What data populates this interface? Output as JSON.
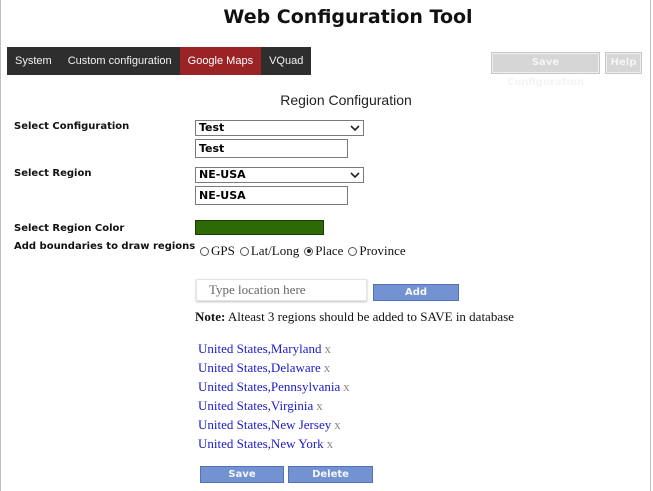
{
  "app": {
    "title": "Web Configuration Tool"
  },
  "nav": {
    "tabs": [
      {
        "label": "System",
        "active": false
      },
      {
        "label": "Custom configuration",
        "active": false
      },
      {
        "label": "Google Maps",
        "active": true
      },
      {
        "label": "VQuad",
        "active": false
      }
    ]
  },
  "toolbar": {
    "save_label": "Save Configuration",
    "help_label": "Help"
  },
  "section": {
    "title": "Region Configuration"
  },
  "form": {
    "config_label": "Select Configuration",
    "config_selected": "Test",
    "config_name": "Test",
    "region_label": "Select Region",
    "region_selected": "NE-USA",
    "region_name": "NE-USA",
    "color_label": "Select Region Color",
    "color_value": "#2c6a06",
    "boundaries_label": "Add boundaries to draw regions",
    "boundary_options": [
      {
        "label": "GPS",
        "checked": false
      },
      {
        "label": "Lat/Long",
        "checked": false
      },
      {
        "label": "Place",
        "checked": true
      },
      {
        "label": "Province",
        "checked": false
      }
    ],
    "location_placeholder": "Type location here",
    "add_label": "Add",
    "note_prefix": "Note:",
    "note_text": " Alteast 3 regions should be added to SAVE in database"
  },
  "regions": [
    {
      "name": "United States,Maryland",
      "remove": "x"
    },
    {
      "name": "United States,Delaware",
      "remove": "x"
    },
    {
      "name": "United States,Pennsylvania",
      "remove": "x"
    },
    {
      "name": "United States,Virginia",
      "remove": "x"
    },
    {
      "name": "United States,New Jersey",
      "remove": "x"
    },
    {
      "name": "United States,New York",
      "remove": "x"
    }
  ],
  "actions": {
    "save_label": "Save",
    "delete_label": "Delete"
  },
  "colors": {
    "nav_bg": "#2e2e2e",
    "nav_active": "#9b2326",
    "button_blue": "#7292d2",
    "link": "#1a1acc"
  }
}
